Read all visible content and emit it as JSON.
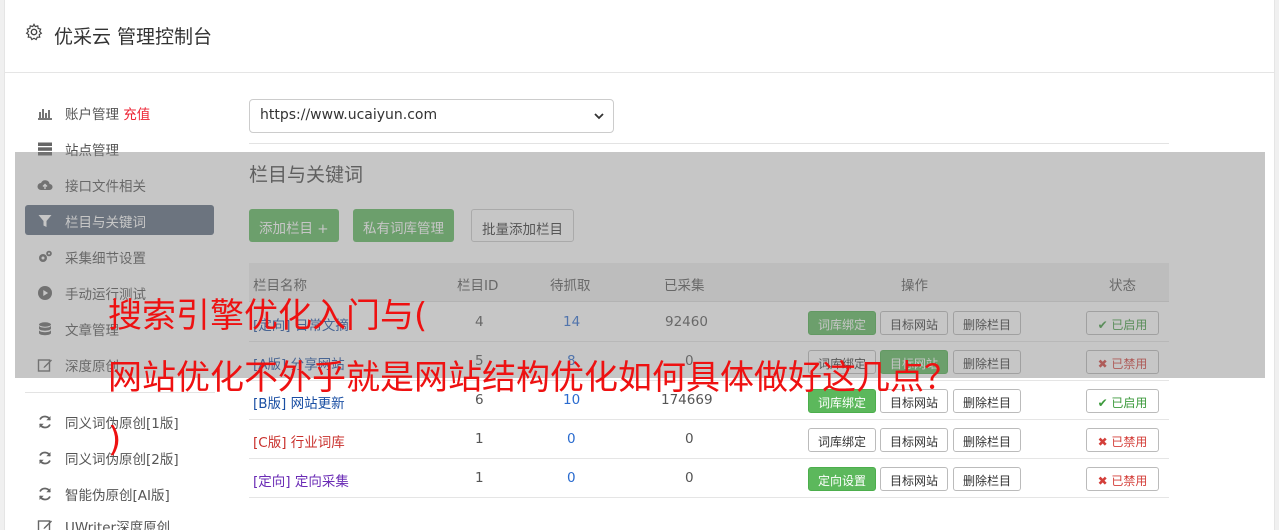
{
  "header": {
    "title": "优采云 管理控制台",
    "icon": "gear-icon"
  },
  "sidebar": {
    "items": [
      {
        "label": "账户管理",
        "badge": "充值",
        "icon": "bar-chart-icon"
      },
      {
        "label": "站点管理",
        "icon": "server-icon"
      },
      {
        "label": "接口文件相关",
        "icon": "cloud-upload-icon"
      },
      {
        "label": "栏目与关键词",
        "icon": "filter-icon"
      },
      {
        "label": "采集细节设置",
        "icon": "cogs-icon"
      },
      {
        "label": "手动运行测试",
        "icon": "play-circle-icon"
      },
      {
        "label": "文章管理",
        "icon": "database-icon"
      },
      {
        "label": "深度原创",
        "icon": "edit-icon"
      },
      {
        "label": "同义词伪原创[1版]",
        "icon": "refresh-icon"
      },
      {
        "label": "同义词伪原创[2版]",
        "icon": "refresh-icon"
      },
      {
        "label": "智能伪原创[AI版]",
        "icon": "refresh-icon"
      },
      {
        "label": "UWriter深度原创",
        "icon": "edit-icon"
      }
    ]
  },
  "site_select": {
    "value": "https://www.ucaiyun.com"
  },
  "section": {
    "title": "栏目与关键词",
    "add_button": "添加栏目 +",
    "private_lib_button": "私有词库管理",
    "batch_add_button": "批量添加栏目"
  },
  "table": {
    "headers": [
      "栏目名称",
      "栏目ID",
      "待抓取",
      "已采集",
      "操作",
      "状态"
    ],
    "rows": [
      {
        "tag": "[定向]",
        "name": "日常文摘",
        "id": "4",
        "pending": "14",
        "collected": "92460",
        "bind": "词库绑定",
        "target": "目标网站",
        "delete": "删除栏目",
        "status": "✔ 已启用"
      },
      {
        "tag": "[A版]",
        "name": "分享网站",
        "id": "5",
        "pending": "8",
        "collected": "0",
        "bind": "词库绑定",
        "target": "目标网站",
        "delete": "删除栏目",
        "status": "✖ 已禁用"
      },
      {
        "tag": "[B版]",
        "name": "网站更新",
        "id": "6",
        "pending": "10",
        "collected": "174669",
        "bind": "词库绑定",
        "target": "目标网站",
        "delete": "删除栏目",
        "status": "✔ 已启用"
      },
      {
        "tag": "[C版]",
        "name": "行业词库",
        "id": "1",
        "pending": "0",
        "collected": "0",
        "bind": "词库绑定",
        "target": "目标网站",
        "delete": "删除栏目",
        "status": "✖ 已禁用"
      },
      {
        "tag": "[定向]",
        "name": "定向采集",
        "id": "1",
        "pending": "0",
        "collected": "0",
        "bind": "定向设置",
        "target": "目标网站",
        "delete": "删除栏目",
        "status": "✖ 已禁用"
      }
    ]
  },
  "overlay_text": {
    "line1": "搜索引擎优化入门与(",
    "line2": "网站优化不外乎就是网站结构优化如何具体做好这几点？",
    "line3": ")"
  },
  "colors": {
    "accent_green": "#5cb85c",
    "active_nav": "#5b6a7e",
    "overlay_text": "#ee1111"
  }
}
